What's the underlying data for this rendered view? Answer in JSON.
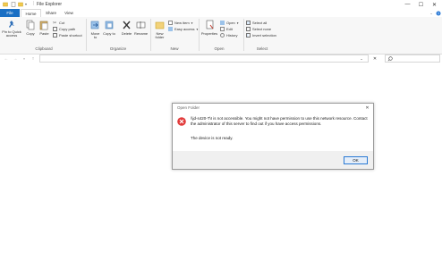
{
  "window": {
    "title": "File Explorer",
    "controls": {
      "minimize": "—",
      "maximize": "☐",
      "close": "✕"
    }
  },
  "tabs": [
    "File",
    "Home",
    "Share",
    "View"
  ],
  "ribbon": {
    "clipboard": {
      "label": "Clipboard",
      "pin_label": "Pin to Quick access",
      "copy_label": "Copy",
      "paste_label": "Paste",
      "cut_label": "Cut",
      "copy_path_label": "Copy path",
      "paste_shortcut_label": "Paste shortcut"
    },
    "organize": {
      "label": "Organize",
      "move_to_label": "Move to",
      "copy_to_label": "Copy to",
      "delete_label": "Delete",
      "rename_label": "Rename"
    },
    "new": {
      "label": "New",
      "new_folder_label": "New folder",
      "new_item_label": "New item",
      "easy_access_label": "Easy access"
    },
    "open": {
      "label": "Open",
      "properties_label": "Properties",
      "open_label": "Open",
      "edit_label": "Edit",
      "history_label": "History"
    },
    "select": {
      "label": "Select",
      "select_all_label": "Select all",
      "select_none_label": "Select none",
      "invert_selection_label": "Invert selection"
    }
  },
  "address": {
    "value": "",
    "search_placeholder": ""
  },
  "dialog": {
    "title": "Open Folder",
    "close": "✕",
    "message": "\\\\jd-s420-T\\I is not accessible. You might not have permission to use this network resource. Contact the administrator of this server to find out if you have access permissions.",
    "detail": "The device is not ready.",
    "ok_label": "OK"
  },
  "colors": {
    "accent": "#1a6fc4",
    "error": "#e23b3b"
  }
}
